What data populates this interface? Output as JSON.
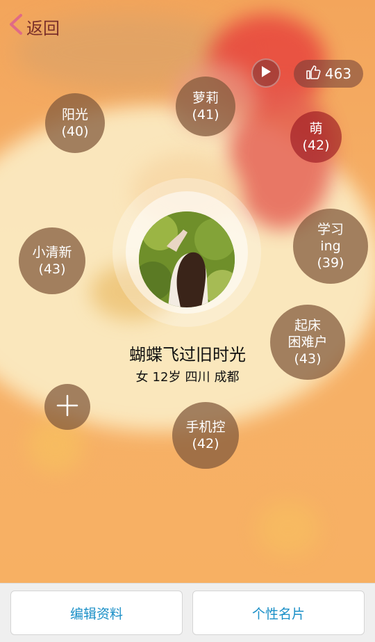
{
  "nav": {
    "back_label": "返回"
  },
  "likes": {
    "count": "463"
  },
  "profile": {
    "name": "蝴蝶飞过旧时光",
    "gender": "女",
    "age": "12岁",
    "province": "四川",
    "city": "成都"
  },
  "tags": [
    {
      "line1": "阳光",
      "line2": "(40)",
      "line3": ""
    },
    {
      "line1": "萝莉",
      "line2": "(41)",
      "line3": ""
    },
    {
      "line1": "萌",
      "line2": "(42)",
      "line3": ""
    },
    {
      "line1": "小清新",
      "line2": "(43)",
      "line3": ""
    },
    {
      "line1": "学习",
      "line2": "ing",
      "line3": "(39)"
    },
    {
      "line1": "起床",
      "line2": "困难户",
      "line3": "(43)"
    },
    {
      "line1": "手机控",
      "line2": "(42)",
      "line3": ""
    }
  ],
  "actions": {
    "edit_label": "编辑资料",
    "card_label": "个性名片"
  },
  "icons": {
    "back": "chevron-left-icon",
    "play": "play-icon",
    "like": "thumbs-up-icon",
    "add": "plus-icon"
  },
  "colors": {
    "accent_link": "#1a8fc7",
    "tag_bubble": "#80583a",
    "background": "#f5a95c"
  }
}
